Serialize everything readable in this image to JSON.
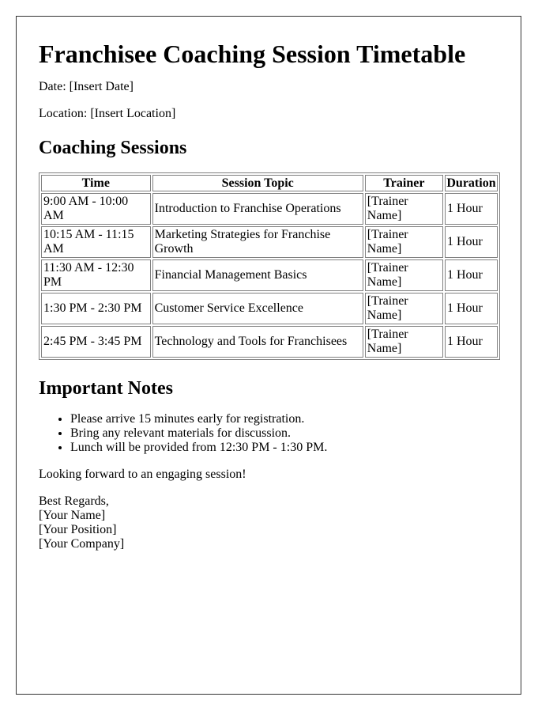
{
  "document": {
    "title": "Franchisee Coaching Session Timetable",
    "date_line": "Date: [Insert Date]",
    "location_line": "Location: [Insert Location]",
    "sessions_heading": "Coaching Sessions",
    "table": {
      "headers": [
        "Time",
        "Session Topic",
        "Trainer",
        "Duration"
      ],
      "rows": [
        {
          "time": "9:00 AM - 10:00 AM",
          "topic": "Introduction to Franchise Operations",
          "trainer": "[Trainer Name]",
          "duration": "1 Hour"
        },
        {
          "time": "10:15 AM - 11:15 AM",
          "topic": "Marketing Strategies for Franchise Growth",
          "trainer": "[Trainer Name]",
          "duration": "1 Hour"
        },
        {
          "time": "11:30 AM - 12:30 PM",
          "topic": "Financial Management Basics",
          "trainer": "[Trainer Name]",
          "duration": "1 Hour"
        },
        {
          "time": "1:30 PM - 2:30 PM",
          "topic": "Customer Service Excellence",
          "trainer": "[Trainer Name]",
          "duration": "1 Hour"
        },
        {
          "time": "2:45 PM - 3:45 PM",
          "topic": "Technology and Tools for Franchisees",
          "trainer": "[Trainer Name]",
          "duration": "1 Hour"
        }
      ]
    },
    "notes_heading": "Important Notes",
    "notes": [
      "Please arrive 15 minutes early for registration.",
      "Bring any relevant materials for discussion.",
      "Lunch will be provided from 12:30 PM - 1:30 PM."
    ],
    "closing_line": "Looking forward to an engaging session!",
    "signature": {
      "salutation": "Best Regards,",
      "name": "[Your Name]",
      "position": "[Your Position]",
      "company": "[Your Company]"
    }
  }
}
